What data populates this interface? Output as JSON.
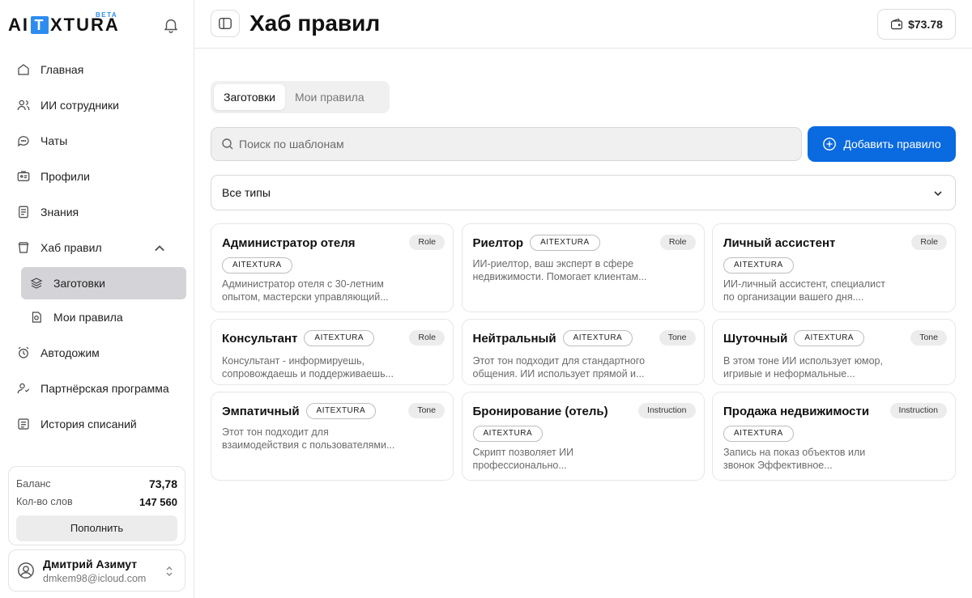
{
  "sidebar": {
    "logo": {
      "left": "AI",
      "box": "T",
      "right": "XTURA",
      "beta": "BETA"
    },
    "items": [
      {
        "label": "Главная",
        "icon": "home-icon"
      },
      {
        "label": "ИИ сотрудники",
        "icon": "users-icon"
      },
      {
        "label": "Чаты",
        "icon": "chat-icon"
      },
      {
        "label": "Профили",
        "icon": "profile-card-icon"
      },
      {
        "label": "Знания",
        "icon": "document-icon"
      },
      {
        "label": "Хаб правил",
        "icon": "hub-icon",
        "expanded": true
      },
      {
        "label": "Заготовки",
        "icon": "layers-icon",
        "sub": true,
        "active": true
      },
      {
        "label": "Мои правила",
        "icon": "rule-icon",
        "sub": true
      },
      {
        "label": "Автодожим",
        "icon": "alarm-icon"
      },
      {
        "label": "Партнёрская программа",
        "icon": "partner-icon"
      },
      {
        "label": "История списаний",
        "icon": "history-icon"
      }
    ],
    "balance": {
      "balance_label": "Баланс",
      "balance_value": "73,78",
      "words_label": "Кол-во слов",
      "words_value": "147 560",
      "topup_label": "Пополнить"
    },
    "user": {
      "name": "Дмитрий Азимут",
      "email": "dmkem98@icloud.com"
    }
  },
  "header": {
    "title": "Хаб правил",
    "wallet": "$73.78"
  },
  "tabs": [
    {
      "label": "Заготовки",
      "active": true
    },
    {
      "label": "Мои правила",
      "active": false
    }
  ],
  "search": {
    "placeholder": "Поиск по шаблонам"
  },
  "add_button": "Добавить правило",
  "filter": {
    "selected": "Все типы"
  },
  "cards": [
    {
      "title": "Администратор отеля",
      "type": "Role",
      "badge": "AITEXTURA",
      "badge_inline": false,
      "line1": "Администратор отеля с 30-летним",
      "line2": "опытом, мастерски управляющий..."
    },
    {
      "title": "Риелтор",
      "type": "Role",
      "badge": "AITEXTURA",
      "badge_inline": true,
      "line1": "ИИ-риелтор, ваш эксперт в сфере",
      "line2": "недвижимости. Помогает клиентам..."
    },
    {
      "title": "Личный ассистент",
      "type": "Role",
      "badge": "AITEXTURA",
      "badge_inline": false,
      "line1": "ИИ-личный ассистент, специалист",
      "line2": "по организации вашего дня...."
    },
    {
      "title": "Консультант",
      "type": "Role",
      "badge": "AITEXTURA",
      "badge_inline": true,
      "line1": "Консультант - информируешь,",
      "line2": "сопровождаешь и поддерживаешь..."
    },
    {
      "title": "Нейтральный",
      "type": "Tone",
      "badge": "AITEXTURA",
      "badge_inline": true,
      "line1": "Этот тон подходит для стандартного",
      "line2": "общения. ИИ использует прямой и..."
    },
    {
      "title": "Шуточный",
      "type": "Tone",
      "badge": "AITEXTURA",
      "badge_inline": true,
      "line1": "В этом тоне ИИ использует юмор,",
      "line2": "игривые и неформальные..."
    },
    {
      "title": "Эмпатичный",
      "type": "Tone",
      "badge": "AITEXTURA",
      "badge_inline": true,
      "line1": "Этот тон подходит для",
      "line2": "взаимодействия с пользователями..."
    },
    {
      "title": "Бронирование (отель)",
      "type": "Instruction",
      "badge": "AITEXTURA",
      "badge_inline": false,
      "line1": "Скрипт позволяет ИИ",
      "line2": "профессионально..."
    },
    {
      "title": "Продажа недвижимости",
      "type": "Instruction",
      "badge": "AITEXTURA",
      "badge_inline": false,
      "line1": "Запись на показ объектов или",
      "line2": "звонок Эффективное..."
    }
  ],
  "colors": {
    "accent": "#0a6ae0",
    "logo_accent": "#2d8cf0",
    "active_nav": "#d4d4d8"
  }
}
